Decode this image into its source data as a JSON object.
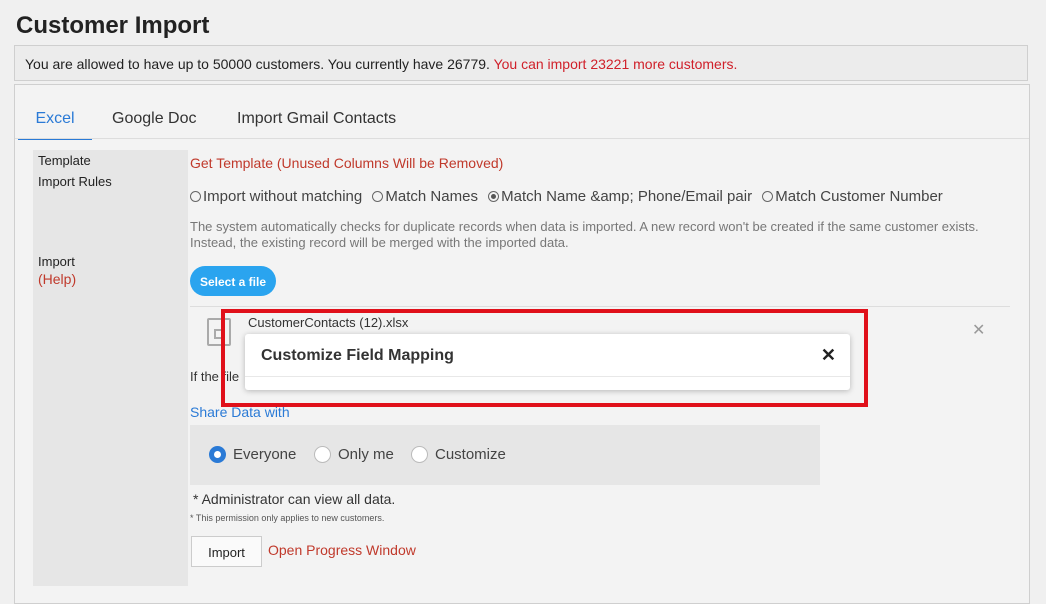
{
  "page": {
    "title": "Customer Import"
  },
  "notice": {
    "text": "You are allowed to have up to 50000 customers. You currently have 26779.",
    "highlight": "You can import 23221 more customers.",
    "highlight_color": "#d0202a"
  },
  "tabs": [
    {
      "label": "Excel",
      "active": true
    },
    {
      "label": "Google Doc",
      "active": false
    },
    {
      "label": "Import Gmail Contacts",
      "active": false
    }
  ],
  "form": {
    "template_label": "Template",
    "template_link": "Get Template (Unused Columns Will be Removed)",
    "rules_label": "Import Rules",
    "rules": [
      {
        "label": "Import without matching",
        "selected": false
      },
      {
        "label": "Match Names",
        "selected": false
      },
      {
        "label": "Match Name &amp; Phone/Email pair",
        "selected": true
      },
      {
        "label": "Match Customer Number",
        "selected": false
      }
    ],
    "rules_description": "The system automatically checks for duplicate records when data is imported. A new record won't be created if the same customer exists. Instead, the existing record will be merged with the imported data.",
    "import_label": "Import",
    "help_label": "(Help)",
    "select_file_label": "Select a file",
    "file_name": "CustomerContacts (12).xlsx",
    "if_text": "If the file",
    "share_label": "Share Data with",
    "share_options": [
      {
        "label": "Everyone",
        "selected": true
      },
      {
        "label": "Only me",
        "selected": false
      },
      {
        "label": "Customize",
        "selected": false
      }
    ],
    "admin_note": "*  Administrator can view all data.",
    "permission_note": "*  This permission only applies to new customers.",
    "import_button": "Import",
    "progress_link": "Open Progress Window"
  },
  "modal": {
    "title": "Customize Field Mapping",
    "close_glyph": "✕"
  },
  "colors": {
    "accent": "#2a7ad6",
    "link_red": "#c0392b",
    "button_blue": "#2aa4ef",
    "highlight_box": "#e0101a"
  }
}
